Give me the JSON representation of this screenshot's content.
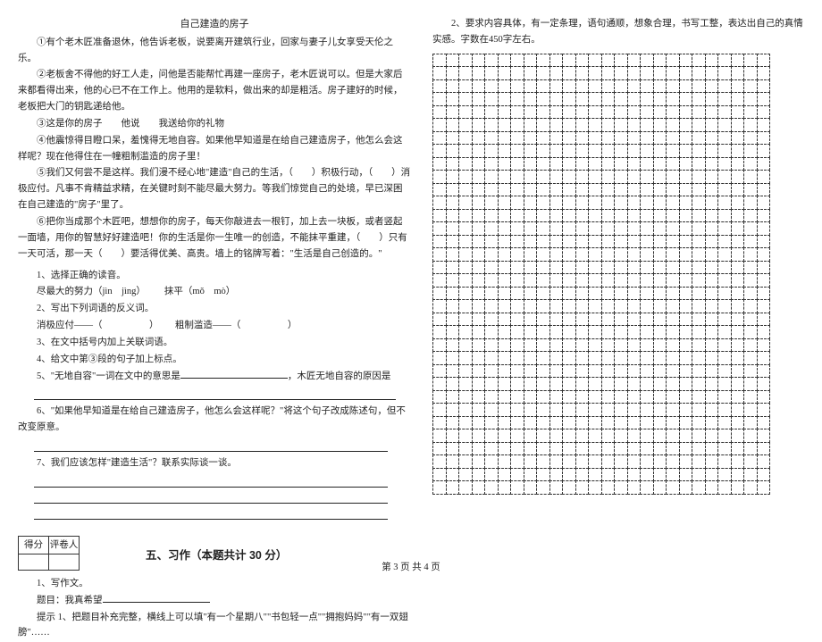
{
  "left": {
    "story_title": "自己建造的房子",
    "p1": "①有个老木匠准备退休，他告诉老板，说要离开建筑行业，回家与妻子儿女享受天伦之乐。",
    "p2": "②老板舍不得他的好工人走，问他是否能帮忙再建一座房子，老木匠说可以。但是大家后来都看得出来，他的心已不在工作上。他用的是软料，做出来的却是粗活。房子建好的时候，老板把大门的钥匙递给他。",
    "p3": "③这是你的房子　　他说　　我送给你的礼物",
    "p4": "④他震惊得目瞪口呆，羞愧得无地自容。如果他早知道是在给自己建造房子，他怎么会这样呢？现在他得住在一幢粗制滥造的房子里！",
    "p5": "⑤我们又何尝不是这样。我们漫不经心地\"建造\"自己的生活，（　　）积极行动，（　　）消极应付。凡事不肯精益求精，在关键时刻不能尽最大努力。等我们惊觉自己的处境，早已深困在自己建造的\"房子\"里了。",
    "p6": "⑥把你当成那个木匠吧，想想你的房子，每天你敲进去一根钉，加上去一块板，或者竖起一面墙，用你的智慧好好建造吧！你的生活是你一生唯一的创造，不能抹平重建，（　　）只有一天可活，那一天（　　）要活得优美、高贵。墙上的铭牌写着：\"生活是自己创造的。\"",
    "q1_label": "1、选择正确的读音。",
    "q1_item1_pre": "尽最大的努力（jìn　jìng）",
    "q1_item1_post": "抹平（mǒ　mò）",
    "q2_label": "2、写出下列词语的反义词。",
    "q2_item_a": "消极应付——（　　　　　）",
    "q2_item_b": "粗制滥造——（　　　　　）",
    "q3_label": "3、在文中括号内加上关联词语。",
    "q4_label": "4、给文中第③段的句子加上标点。",
    "q5_prefix": "5、\"无地自容\"一词在文中的意思是",
    "q5_mid": "，木匠无地自容的原因是",
    "q6_text": "6、\"如果他早知道是在给自己建造房子，他怎么会这样呢？\"将这个句子改成陈述句，但不改变原意。",
    "q7_text": "7、我们应该怎样\"建造生活\"？联系实际谈一谈。",
    "score_h1": "得分",
    "score_h2": "评卷人",
    "section5_title": "五、习作（本题共计 30 分）",
    "w1": "1、写作文。",
    "w2": "题目：我真希望",
    "w3": "提示 1、把题目补充完整，横线上可以填\"有一个星期八\"\"书包轻一点\"\"拥抱妈妈\"\"有一双翅膀\"……"
  },
  "right": {
    "req": "2、要求内容具体，有一定条理，语句通顺，想象合理，书写工整，表达出自己的真情实感。字数在450字左右。"
  },
  "grid": {
    "rows": 34,
    "cols": 26
  },
  "footer": "第 3 页  共 4 页"
}
